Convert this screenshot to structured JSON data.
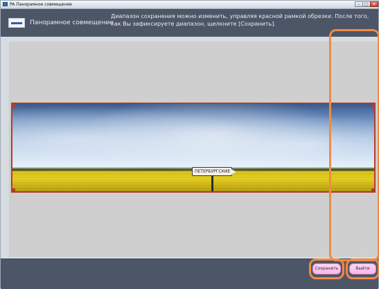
{
  "window": {
    "title": "PA Панорамное совмещение",
    "controls": {
      "minimize": "–",
      "maximize": "□",
      "close": "✕"
    }
  },
  "header": {
    "title": "Панорамное совмещение",
    "instruction": "Диапазон сохранения можно изменить, управляя красной рамкой обрезки. После того, как Вы зафиксируете диапазон, щелкните [Сохранить]."
  },
  "image": {
    "sign_text": "ПЕТЕРБУРГСКИЕ"
  },
  "actions": {
    "save_label": "Сохранить",
    "exit_label": "Выйти"
  },
  "colors": {
    "header_bg": "#4d5667",
    "crop_frame": "#b23b2a",
    "highlight": "#f08a45",
    "button_pink": "#ffb6e8"
  }
}
